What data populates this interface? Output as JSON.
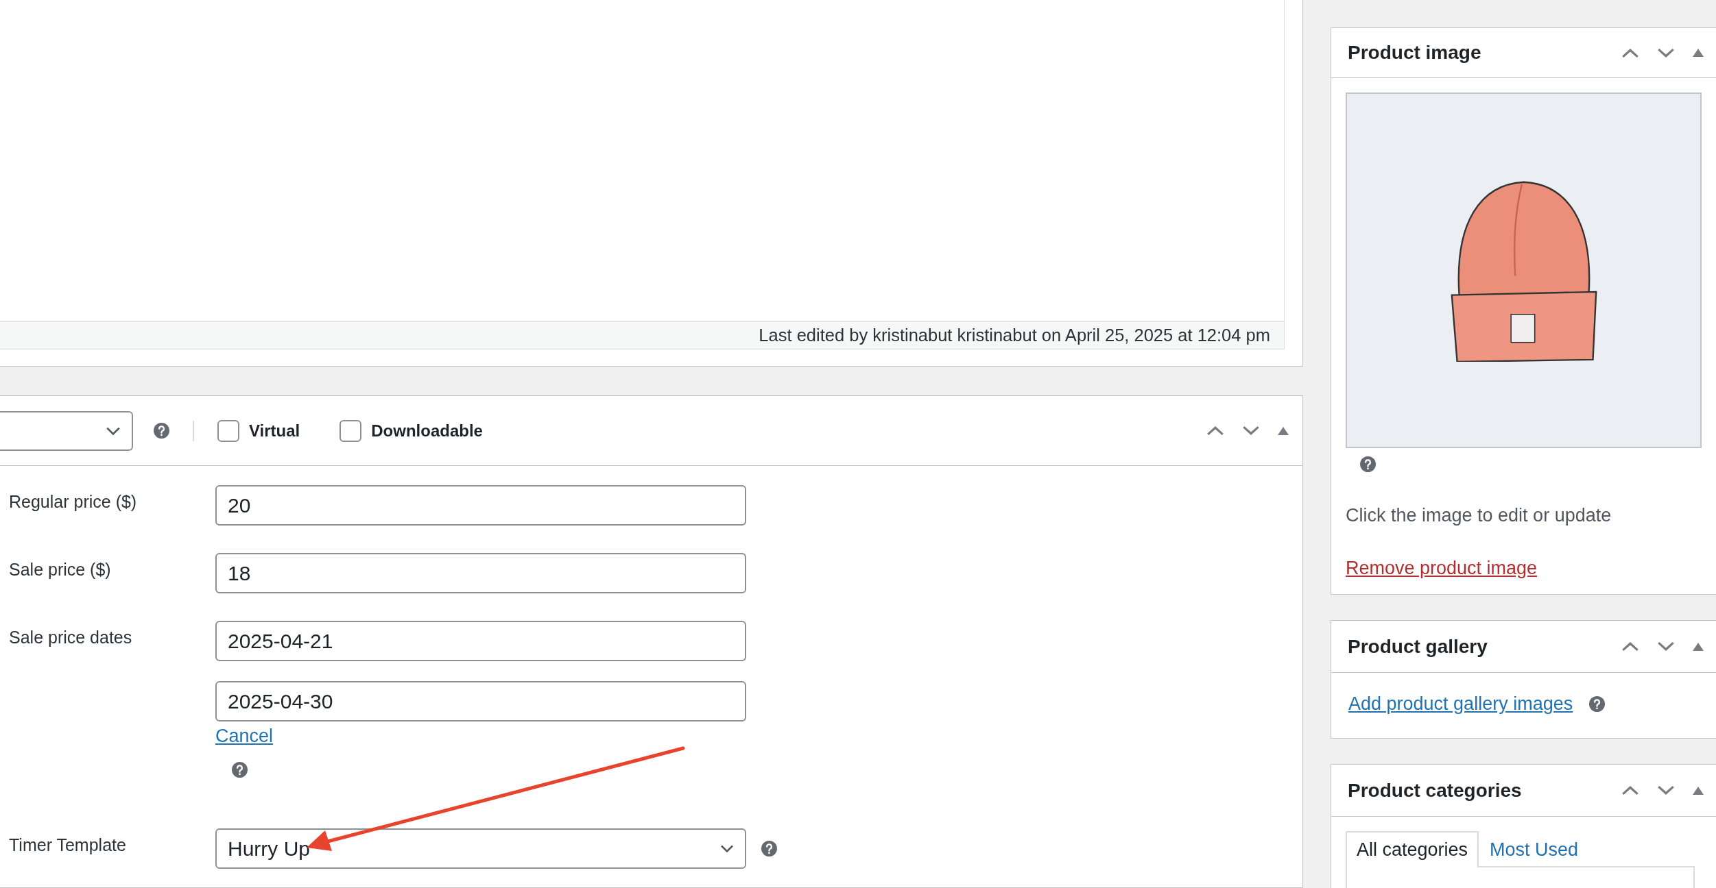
{
  "editor": {
    "status_text": "Last edited by kristinabut kristinabut on April 25, 2025 at 12:04 pm"
  },
  "product_data": {
    "options": [
      {
        "label": "Virtual",
        "checked": false
      },
      {
        "label": "Downloadable",
        "checked": false
      }
    ],
    "fields": [
      {
        "kind": "input",
        "label": "Regular price ($)",
        "value": "20"
      },
      {
        "kind": "input",
        "label": "Sale price ($)",
        "value": "18"
      },
      {
        "kind": "dates",
        "label": "Sale price dates",
        "values": [
          "2025-04-21",
          "2025-04-30"
        ],
        "link": "Cancel"
      },
      {
        "kind": "select",
        "label": "Timer Template",
        "value": "Hurry Up"
      }
    ]
  },
  "sidebar": {
    "boxes": [
      {
        "kind": "image",
        "title": "Product image",
        "hint": "Click the image to edit or update",
        "link": "Remove product image"
      },
      {
        "kind": "gallery",
        "title": "Product gallery",
        "link": "Add product gallery images"
      },
      {
        "kind": "categories",
        "title": "Product categories",
        "tabs": [
          {
            "label": "All categories",
            "selected": true
          },
          {
            "label": "Most Used",
            "selected": false
          }
        ]
      }
    ]
  }
}
